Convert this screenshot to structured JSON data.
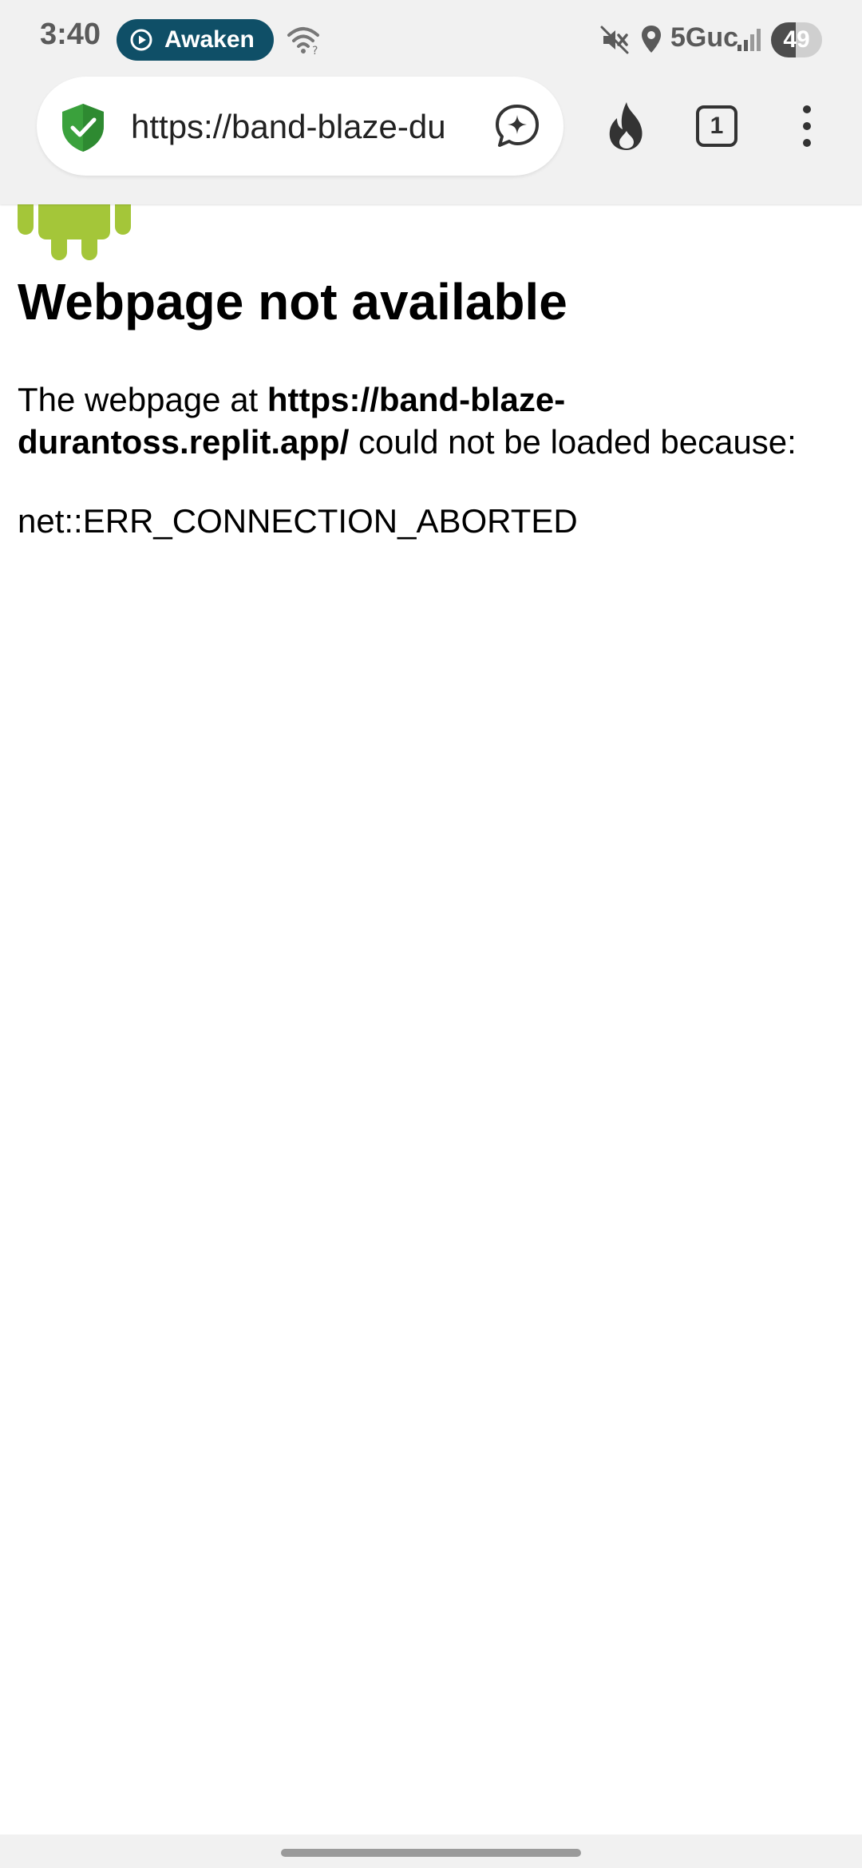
{
  "status_bar": {
    "time": "3:40",
    "notification_pill_label": "Awaken",
    "network": "5Guc",
    "battery_level": "49"
  },
  "toolbar": {
    "url": "https://band-blaze-durantoss.replit.app/",
    "url_display": "https://band-blaze-du",
    "tab_count": "1"
  },
  "error_page": {
    "title": "Webpage not available",
    "desc_prefix": "The webpage at ",
    "desc_url": "https://band-blaze-durantoss.replit.app/",
    "desc_suffix": " could not be loaded because:",
    "error_code": "net::ERR_CONNECTION_ABORTED"
  },
  "colors": {
    "pill_background": "#0f4f67",
    "shield_green": "#3aa13c",
    "android_green": "#a4c639",
    "chrome_background": "#f1f1f1"
  },
  "icons": {
    "notification_pill": "play-circle-icon",
    "wifi": "wifi-icon",
    "mute": "mute-icon",
    "location": "location-icon",
    "signal": "signal-icon",
    "site_security": "shield-check-icon",
    "assistant": "assistant-sparkle-icon",
    "fire": "fire-icon",
    "menu": "more-vert-icon",
    "error_graphic": "android-icon"
  }
}
